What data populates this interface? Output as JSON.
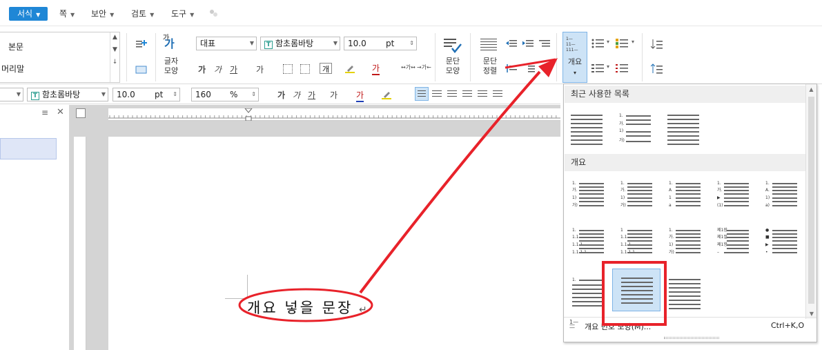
{
  "menu": {
    "items": [
      "서식",
      "쪽",
      "보안",
      "검토",
      "도구"
    ]
  },
  "styles": {
    "items": [
      "본문",
      "머리말"
    ]
  },
  "ribbon": {
    "char_shape_label": "글자\n모양",
    "para_shape_label": "문단\n모양",
    "para_align_label": "문단\n정렬",
    "outline_label": "개요",
    "style_value": "대표",
    "font_value": "함초롬바탕",
    "size_value": "10.0",
    "size_unit": "pt"
  },
  "formatbar": {
    "font_value": "함초롬바탕",
    "size_value": "10.0",
    "size_unit": "pt",
    "zoom_value": "160",
    "zoom_unit": "%"
  },
  "document": {
    "text": "개요 넣을 문장"
  },
  "dropdown": {
    "recent_header": "최근 사용한 목록",
    "outline_header": "개요",
    "footer_label": "개요 번호 모양(M)...",
    "footer_shortcut": "Ctrl+K,O"
  },
  "colors": {
    "accent": "#1f87d6",
    "selection": "#cde3f6",
    "annotation": "#e8222a"
  },
  "icons": [
    "add-style-icon",
    "style-folder-icon",
    "char-shape-icon",
    "para-shape-icon",
    "para-align-icon",
    "outline-icon",
    "bullet-list-icon",
    "numbered-list-icon"
  ]
}
